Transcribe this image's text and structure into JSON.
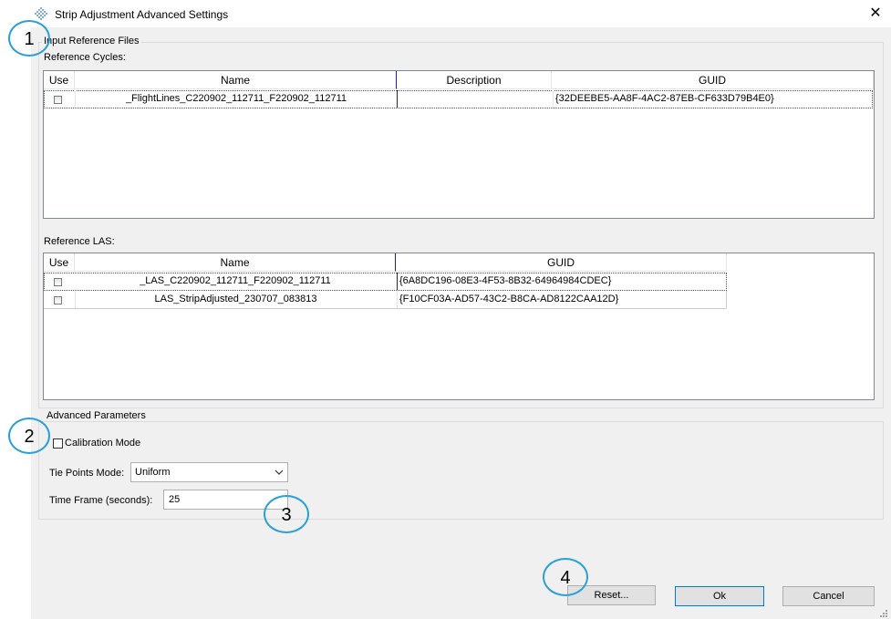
{
  "window": {
    "title": "Strip Adjustment Advanced Settings",
    "close_icon": "close-icon"
  },
  "input_group": {
    "label": "Input Reference Files",
    "cycles": {
      "label": "Reference Cycles:",
      "columns": [
        "Use",
        "Name",
        "Description",
        "GUID"
      ],
      "rows": [
        {
          "checked": false,
          "name": "_FlightLines_C220902_112711_F220902_112711",
          "description": "",
          "guid": "{32DEEBE5-AA8F-4AC2-87EB-CF633D79B4E0}"
        }
      ]
    },
    "las": {
      "label": "Reference LAS:",
      "columns": [
        "Use",
        "Name",
        "GUID"
      ],
      "rows": [
        {
          "checked": false,
          "name": "_LAS_C220902_112711_F220902_112711",
          "guid": "{6A8DC196-08E3-4F53-8B32-64964984CDEC}"
        },
        {
          "checked": false,
          "name": "LAS_StripAdjusted_230707_083813",
          "guid": "{F10CF03A-AD57-43C2-B8CA-AD8122CAA12D}"
        }
      ]
    }
  },
  "advanced": {
    "label": "Advanced Parameters",
    "calibration_mode_label": "Calibration Mode",
    "calibration_mode_checked": false,
    "tie_points_label": "Tie Points Mode:",
    "tie_points_value": "Uniform",
    "time_frame_label": "Time Frame (seconds):",
    "time_frame_value": "25"
  },
  "buttons": {
    "reset": "Reset...",
    "ok": "Ok",
    "cancel": "Cancel"
  },
  "callouts": [
    "1",
    "2",
    "3",
    "4"
  ],
  "colors": {
    "callout": "#2a9fd8",
    "selection": "#0078d7"
  }
}
